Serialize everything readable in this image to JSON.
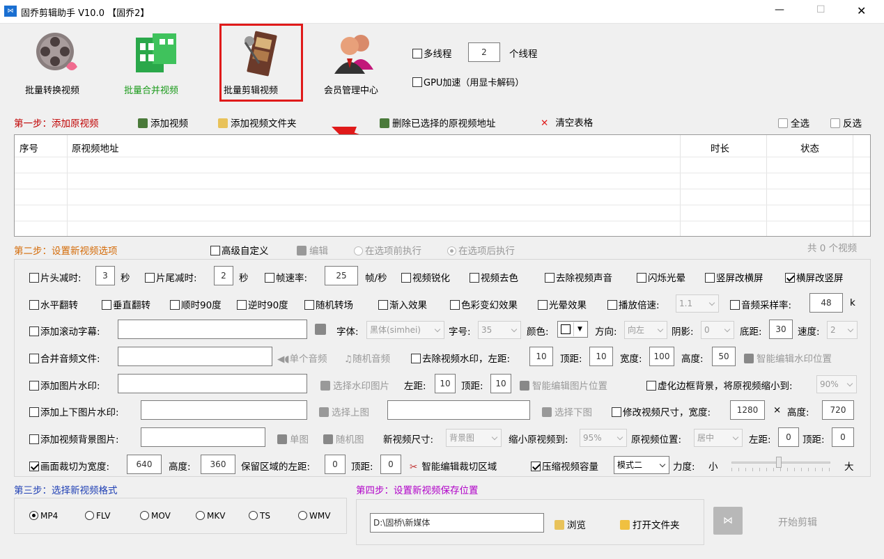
{
  "window": {
    "title": "固乔剪辑助手 V10.0 【固乔2】",
    "min": "—",
    "max": "☐",
    "close": "✕"
  },
  "toolbar": {
    "items": [
      "批量转换视频",
      "批量合并视频",
      "批量剪辑视频",
      "会员管理中心"
    ],
    "multithread_label": "多线程",
    "thread_count": "2",
    "thread_unit": "个线程",
    "gpu_label": "GPU加速（用显卡解码）"
  },
  "step1": {
    "label": "第一步：添加原视频",
    "add_video": "添加视频",
    "add_folder": "添加视频文件夹",
    "delete_selected": "删除已选择的原视频地址",
    "clear_table": "清空表格",
    "select_all": "全选",
    "invert": "反选"
  },
  "table": {
    "columns": [
      "序号",
      "原视频地址",
      "时长",
      "状态"
    ]
  },
  "step2": {
    "label": "第二步：设置新视频选项",
    "advanced": "高级自定义",
    "edit": "编辑",
    "before": "在选项前执行",
    "after": "在选项后执行",
    "count": "共 0 个视频"
  },
  "opts": {
    "r1": {
      "head_cut": "片头减时:",
      "head_val": "3",
      "sec1": "秒",
      "tail_cut": "片尾减时:",
      "tail_val": "2",
      "sec2": "秒",
      "fps": "帧速率:",
      "fps_val": "25",
      "fps_unit": "帧/秒",
      "sharpen": "视频锐化",
      "decolor": "视频去色",
      "mute": "去除视频声音",
      "flash": "闪烁光晕",
      "v2h": "竖屏改横屏",
      "h2v": "横屏改竖屏"
    },
    "r2": {
      "hflip": "水平翻转",
      "vflip": "垂直翻转",
      "cw90": "顺时90度",
      "ccw90": "逆时90度",
      "random": "随机转场",
      "fade": "渐入效果",
      "color": "色彩变幻效果",
      "halo": "光晕效果",
      "speed": "播放倍速:",
      "speed_val": "1.1",
      "sample": "音频采样率:",
      "sample_val": "48",
      "sample_unit": "k"
    },
    "r3": {
      "subtitle": "添加滚动字幕:",
      "font": "字体:",
      "font_val": "黑体(simhei)",
      "size": "字号:",
      "size_val": "35",
      "color": "颜色:",
      "dir": "方向:",
      "dir_val": "向左",
      "shadow": "阴影:",
      "shadow_val": "0",
      "bottom": "底距:",
      "bottom_val": "30",
      "spd": "速度:",
      "spd_val": "2"
    },
    "r4": {
      "audio": "合并音频文件:",
      "single": "单个音频",
      "rand": "随机音频",
      "rm_wm": "去除视频水印，左距:",
      "left_val": "10",
      "top": "顶距:",
      "top_val": "10",
      "width": "宽度:",
      "width_val": "100",
      "height": "高度:",
      "height_val": "50",
      "smart": "智能编辑水印位置"
    },
    "r5": {
      "img_wm": "添加图片水印:",
      "choose": "选择水印图片",
      "left": "左距:",
      "left_val": "10",
      "top": "顶距:",
      "top_val": "10",
      "smart": "智能编辑图片位置",
      "blur": "虚化边框背景，将原视频缩小到:",
      "blur_val": "90%"
    },
    "r6": {
      "tb_wm": "添加上下图片水印:",
      "top_img": "选择上图",
      "bottom_img": "选择下图",
      "resize": "修改视频尺寸，宽度:",
      "w_val": "1280",
      "x": "×",
      "h": "高度:",
      "h_val": "720"
    },
    "r7": {
      "bg": "添加视频背景图片:",
      "single": "单图",
      "rand": "随机图",
      "newsize": "新视频尺寸:",
      "newsize_val": "背景图",
      "shrink": "缩小原视频到:",
      "shrink_val": "95%",
      "pos": "原视频位置:",
      "pos_val": "居中",
      "left": "左距:",
      "left_val": "0",
      "top": "顶距:",
      "top_val": "0"
    },
    "r8": {
      "crop": "画面裁切为宽度:",
      "cw": "640",
      "ch_label": "高度:",
      "ch": "360",
      "keep": "保留区域的左距:",
      "kl": "0",
      "top": "顶距:",
      "kt": "0",
      "smart": "智能编辑裁切区域",
      "compress": "压缩视频容量",
      "mode": "模式二",
      "force": "力度:",
      "small": "小",
      "big": "大"
    }
  },
  "step3": {
    "label": "第三步：选择新视频格式",
    "formats": [
      "MP4",
      "FLV",
      "MOV",
      "MKV",
      "TS",
      "WMV"
    ]
  },
  "step4": {
    "label": "第四步：设置新视频保存位置",
    "path": "D:\\固桥\\新媒体",
    "browse": "浏览",
    "open": "打开文件夹",
    "start": "开始剪辑"
  }
}
